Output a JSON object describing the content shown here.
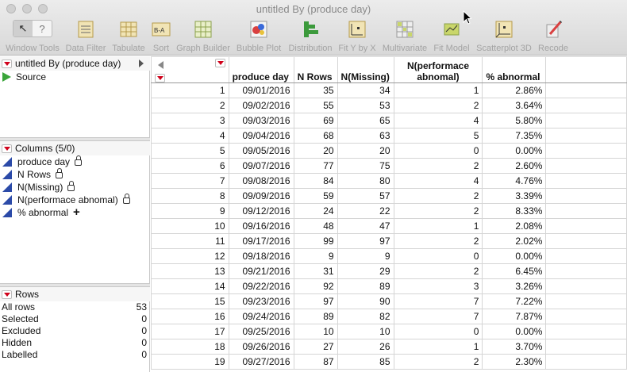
{
  "window": {
    "title": "untitled By (produce day)"
  },
  "toolbar": [
    {
      "label": "Window Tools",
      "icon": "window-tools-icon"
    },
    {
      "label": "Data Filter",
      "icon": "data-filter-icon"
    },
    {
      "label": "Tabulate",
      "icon": "tabulate-icon"
    },
    {
      "label": "Sort",
      "icon": "sort-icon"
    },
    {
      "label": "Graph Builder",
      "icon": "graph-builder-icon"
    },
    {
      "label": "Bubble Plot",
      "icon": "bubble-plot-icon"
    },
    {
      "label": "Distribution",
      "icon": "distribution-icon"
    },
    {
      "label": "Fit Y by X",
      "icon": "fit-y-by-x-icon"
    },
    {
      "label": "Multivariate",
      "icon": "multivariate-icon"
    },
    {
      "label": "Fit Model",
      "icon": "fit-model-icon"
    },
    {
      "label": "Scatterplot 3D",
      "icon": "scatterplot-3d-icon"
    },
    {
      "label": "Recode",
      "icon": "recode-icon"
    }
  ],
  "table_panel": {
    "name": "untitled By (produce day)",
    "source": "Source"
  },
  "columns_panel": {
    "title": "Columns (5/0)",
    "items": [
      {
        "name": "produce day",
        "lock": true
      },
      {
        "name": "N Rows",
        "lock": true
      },
      {
        "name": "N(Missing)",
        "lock": true
      },
      {
        "name": "N(performace abnomal)",
        "lock": true
      },
      {
        "name": "% abnormal",
        "lock": false
      }
    ]
  },
  "rows_panel": {
    "title": "Rows",
    "stats": [
      {
        "label": "All rows",
        "value": "53"
      },
      {
        "label": "Selected",
        "value": "0"
      },
      {
        "label": "Excluded",
        "value": "0"
      },
      {
        "label": "Hidden",
        "value": "0"
      },
      {
        "label": "Labelled",
        "value": "0"
      }
    ]
  },
  "grid": {
    "headers": [
      "produce day",
      "N Rows",
      "N(Missing)",
      "N(performace abnomal)",
      "% abnormal"
    ],
    "rows": [
      [
        "1",
        "09/01/2016",
        "35",
        "34",
        "1",
        "2.86%"
      ],
      [
        "2",
        "09/02/2016",
        "55",
        "53",
        "2",
        "3.64%"
      ],
      [
        "3",
        "09/03/2016",
        "69",
        "65",
        "4",
        "5.80%"
      ],
      [
        "4",
        "09/04/2016",
        "68",
        "63",
        "5",
        "7.35%"
      ],
      [
        "5",
        "09/05/2016",
        "20",
        "20",
        "0",
        "0.00%"
      ],
      [
        "6",
        "09/07/2016",
        "77",
        "75",
        "2",
        "2.60%"
      ],
      [
        "7",
        "09/08/2016",
        "84",
        "80",
        "4",
        "4.76%"
      ],
      [
        "8",
        "09/09/2016",
        "59",
        "57",
        "2",
        "3.39%"
      ],
      [
        "9",
        "09/12/2016",
        "24",
        "22",
        "2",
        "8.33%"
      ],
      [
        "10",
        "09/16/2016",
        "48",
        "47",
        "1",
        "2.08%"
      ],
      [
        "11",
        "09/17/2016",
        "99",
        "97",
        "2",
        "2.02%"
      ],
      [
        "12",
        "09/18/2016",
        "9",
        "9",
        "0",
        "0.00%"
      ],
      [
        "13",
        "09/21/2016",
        "31",
        "29",
        "2",
        "6.45%"
      ],
      [
        "14",
        "09/22/2016",
        "92",
        "89",
        "3",
        "3.26%"
      ],
      [
        "15",
        "09/23/2016",
        "97",
        "90",
        "7",
        "7.22%"
      ],
      [
        "16",
        "09/24/2016",
        "89",
        "82",
        "7",
        "7.87%"
      ],
      [
        "17",
        "09/25/2016",
        "10",
        "10",
        "0",
        "0.00%"
      ],
      [
        "18",
        "09/26/2016",
        "27",
        "26",
        "1",
        "3.70%"
      ],
      [
        "19",
        "09/27/2016",
        "87",
        "85",
        "2",
        "2.30%"
      ]
    ]
  },
  "colors": {
    "accent_red": "#d0021b",
    "column_blue": "#2b4aa8",
    "source_green": "#3aa53a"
  }
}
